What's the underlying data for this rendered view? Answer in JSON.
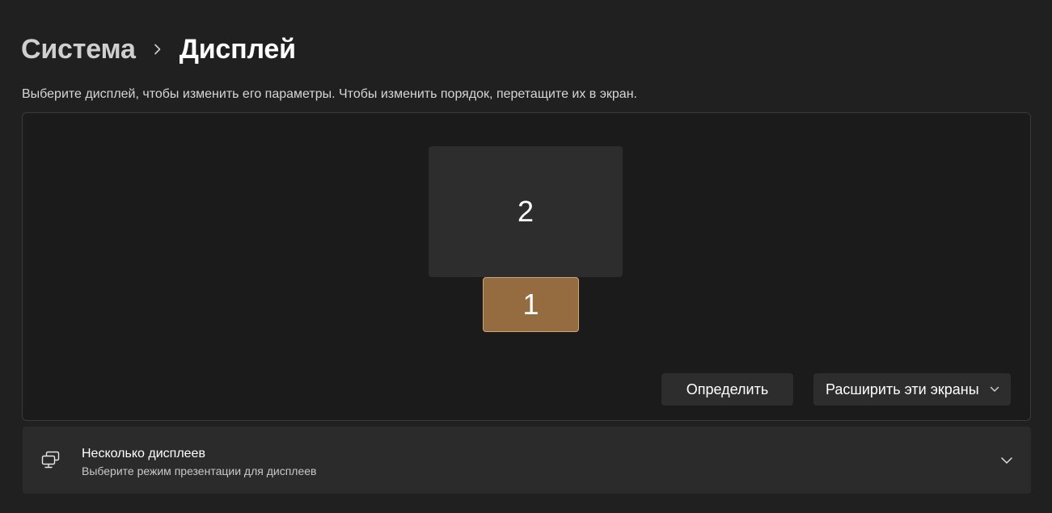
{
  "breadcrumb": {
    "parent": "Система",
    "current": "Дисплей"
  },
  "instruction": "Выберите дисплей, чтобы изменить его параметры. Чтобы изменить порядок, перетащите их в экран.",
  "displays": [
    {
      "number": "2",
      "selected": false
    },
    {
      "number": "1",
      "selected": true,
      "color": "#956c40"
    }
  ],
  "buttons": {
    "identify": "Определить",
    "mode": "Расширить эти экраны"
  },
  "multiple_displays": {
    "title": "Несколько дисплеев",
    "subtitle": "Выберите режим презентации для дисплеев",
    "icon": "multiple-displays-icon"
  },
  "colors": {
    "accent": "#956c40",
    "background": "#202020"
  }
}
